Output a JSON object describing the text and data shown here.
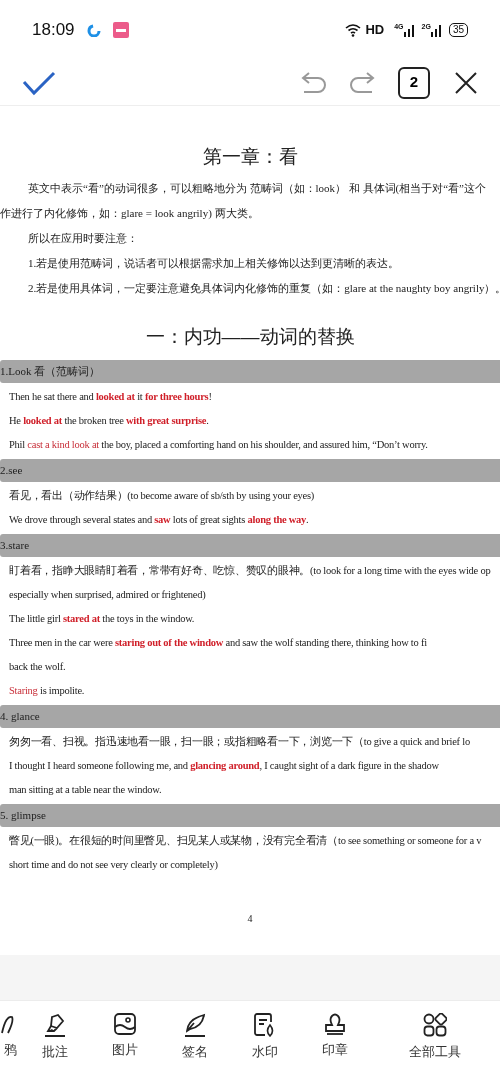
{
  "status_bar": {
    "time": "18:09",
    "hd": "HD",
    "signal_1": "4G",
    "signal_2": "2G",
    "battery": "35"
  },
  "toolbar": {
    "page_count": "2"
  },
  "document": {
    "title": "第一章：看",
    "intro": [
      {
        "text": "英文中表示“看”的动词很多，可以粗略地分为 范畴词（如：look） 和 具体词(相当于对“看”这个",
        "indent": true
      },
      {
        "text": "作进行了内化修饰，如：glare = look angrily) 两大类。",
        "indent": false
      },
      {
        "text": "所以在应用时要注意：",
        "indent": true
      },
      {
        "text": "1.若是使用范畴词，说话者可以根据需求加上相关修饰以达到更清晰的表达。",
        "indent": true
      },
      {
        "text": "2.若是使用具体词，一定要注意避免具体词内化修饰的重复（如：glare at the naughty boy angrily）。",
        "indent": true
      }
    ],
    "section_heading": "一：内功——动词的替换",
    "sections": [
      {
        "heading": "1.Look 看（范畴词）",
        "lines": [
          [
            {
              "text": "Then he sat there and ",
              "kind": "plain"
            },
            {
              "text": "looked at",
              "kind": "emphasis"
            },
            {
              "text": " it ",
              "kind": "plain"
            },
            {
              "text": "for three hours",
              "kind": "emphasis"
            },
            {
              "text": "!",
              "kind": "plain"
            }
          ],
          [
            {
              "text": "He ",
              "kind": "plain"
            },
            {
              "text": "looked at",
              "kind": "emphasis"
            },
            {
              "text": " the broken tree ",
              "kind": "plain"
            },
            {
              "text": "with great surprise",
              "kind": "emphasis"
            },
            {
              "text": ".",
              "kind": "plain"
            }
          ],
          [
            {
              "text": "Phil ",
              "kind": "plain"
            },
            {
              "text": "cast a kind look at",
              "kind": "highlight"
            },
            {
              "text": " the boy, placed a comforting hand on his shoulder, and assured him, “Don’t worry.",
              "kind": "plain"
            }
          ]
        ]
      },
      {
        "heading": "2.see",
        "lines": [
          [
            {
              "text": "看见，看出（动作结果）(to become aware of sb/sth by using your eyes)",
              "kind": "plain"
            }
          ],
          [
            {
              "text": "We drove through several states and ",
              "kind": "plain"
            },
            {
              "text": "saw",
              "kind": "emphasis"
            },
            {
              "text": " lots of great sights ",
              "kind": "plain"
            },
            {
              "text": "along the way",
              "kind": "emphasis"
            },
            {
              "text": ".",
              "kind": "plain"
            }
          ]
        ]
      },
      {
        "heading": "3.stare",
        "lines": [
          [
            {
              "text": "盯着看，指睁大眼睛盯着看，常带有好奇、吃惊、赞叹的眼神。(to look for a long time with the eyes wide op",
              "kind": "plain"
            }
          ],
          [
            {
              "text": "especially when surprised, admired or frightened)",
              "kind": "plain"
            }
          ],
          [
            {
              "text": "The little girl ",
              "kind": "plain"
            },
            {
              "text": "stared at",
              "kind": "emphasis"
            },
            {
              "text": " the toys in the window.",
              "kind": "plain"
            }
          ],
          [
            {
              "text": "Three men in the car were ",
              "kind": "plain"
            },
            {
              "text": "staring out of the window",
              "kind": "emphasis"
            },
            {
              "text": " and saw the wolf standing there, thinking how to fi",
              "kind": "plain"
            }
          ],
          [
            {
              "text": "back the wolf.",
              "kind": "plain"
            }
          ],
          [
            {
              "text": "Staring",
              "kind": "highlight"
            },
            {
              "text": " is impolite.",
              "kind": "plain"
            }
          ]
        ]
      },
      {
        "heading": "4. glance",
        "lines": [
          [
            {
              "text": "匆匆一看、扫视。指迅速地看一眼，扫一眼；或指粗略看一下，浏览一下（to give a quick and brief lo",
              "kind": "plain"
            }
          ],
          [
            {
              "text": "I thought I heard someone following me, and ",
              "kind": "plain"
            },
            {
              "text": "glancing around",
              "kind": "emphasis"
            },
            {
              "text": ", I caught sight of a dark figure in the shadow",
              "kind": "plain"
            }
          ],
          [
            {
              "text": "man sitting at a table near the window.",
              "kind": "plain"
            }
          ]
        ]
      },
      {
        "heading": "5. glimpse",
        "lines": [
          [
            {
              "text": "瞥见(一眼)。在很短的时间里瞥见、扫见某人或某物，没有完全看清（to see something or someone for a v",
              "kind": "plain"
            }
          ],
          [
            {
              "text": "short time and do not see very clearly or completely)",
              "kind": "plain"
            }
          ]
        ]
      }
    ],
    "page_number": "4"
  },
  "bottom_tools": [
    {
      "label": "鸦"
    },
    {
      "label": "批注"
    },
    {
      "label": "图片"
    },
    {
      "label": "签名"
    },
    {
      "label": "水印"
    },
    {
      "label": "印章"
    },
    {
      "label": "全部工具"
    }
  ]
}
